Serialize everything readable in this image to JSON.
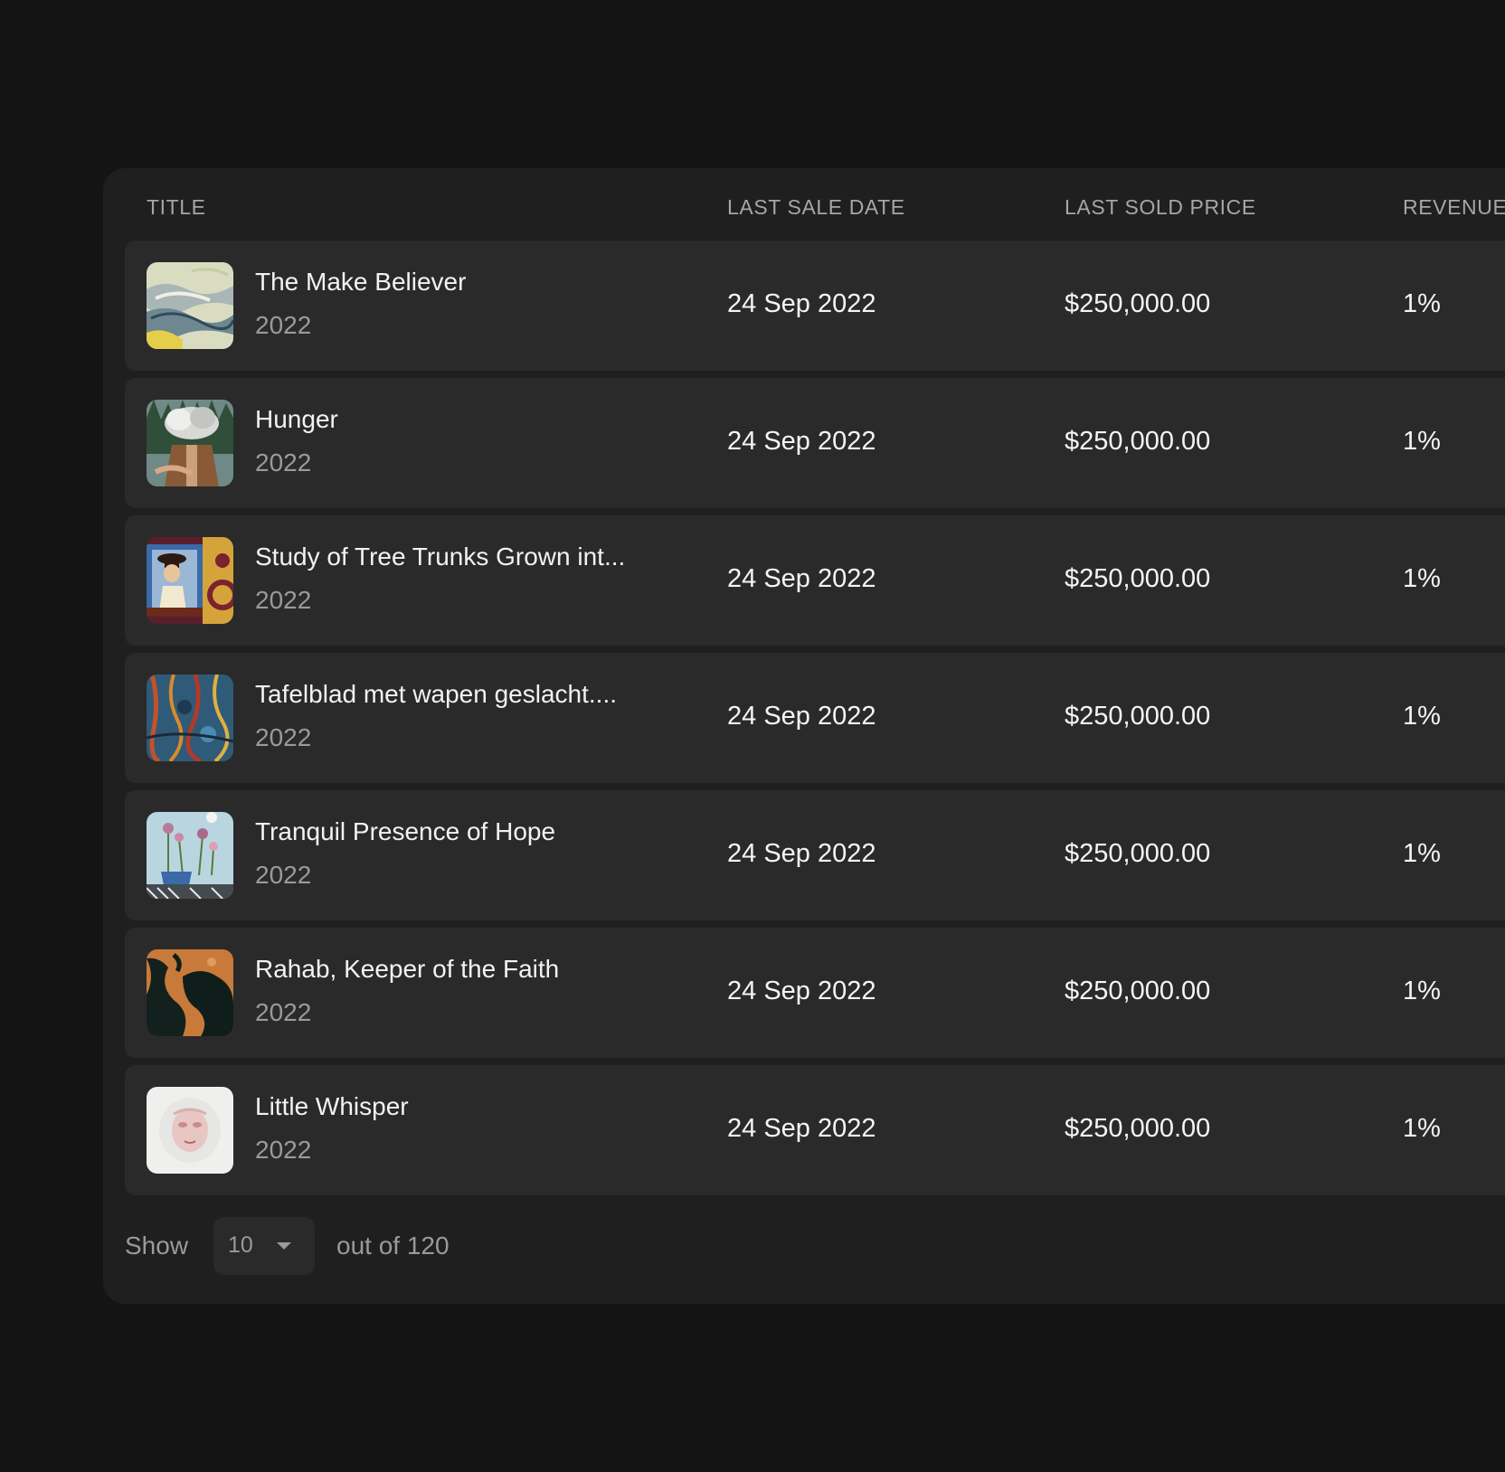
{
  "table": {
    "headers": {
      "title": "TITLE",
      "last_sale_date": "LAST SALE DATE",
      "last_sold_price": "LAST SOLD PRICE",
      "revenue": "REVENUE"
    },
    "rows": [
      {
        "title": "The Make Believer",
        "year": "2022",
        "date": "24 Sep 2022",
        "price": "$250,000.00",
        "revenue": "1%"
      },
      {
        "title": "Hunger",
        "year": "2022",
        "date": "24 Sep 2022",
        "price": "$250,000.00",
        "revenue": "1%"
      },
      {
        "title": "Study of Tree Trunks Grown int...",
        "year": "2022",
        "date": "24 Sep 2022",
        "price": "$250,000.00",
        "revenue": "1%"
      },
      {
        "title": "Tafelblad met wapen geslacht....",
        "year": "2022",
        "date": "24 Sep 2022",
        "price": "$250,000.00",
        "revenue": "1%"
      },
      {
        "title": "Tranquil Presence of Hope",
        "year": "2022",
        "date": "24 Sep 2022",
        "price": "$250,000.00",
        "revenue": "1%"
      },
      {
        "title": "Rahab, Keeper of the Faith",
        "year": "2022",
        "date": "24 Sep 2022",
        "price": "$250,000.00",
        "revenue": "1%"
      },
      {
        "title": "Little Whisper",
        "year": "2022",
        "date": "24 Sep 2022",
        "price": "$250,000.00",
        "revenue": "1%"
      }
    ]
  },
  "footer": {
    "show_label": "Show",
    "page_size": "10",
    "total_label": "out of 120"
  },
  "colors": {
    "background": "#141414",
    "panel": "#1f1f1f",
    "row": "#2a2a2a",
    "muted_text": "#9a9a9a",
    "header_text": "#a6a6a6"
  }
}
